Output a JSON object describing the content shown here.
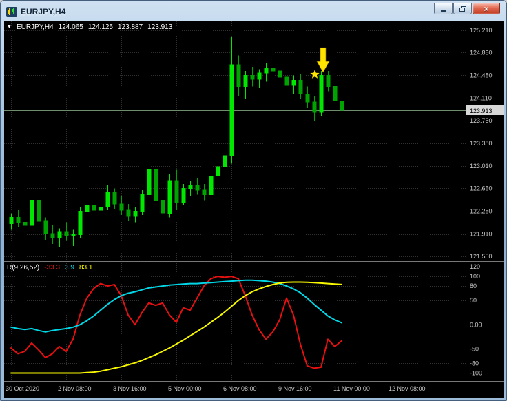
{
  "window": {
    "title": "EURJPY,H4",
    "controls": {
      "minimize": "minimize",
      "maximize": "restore",
      "close": "×"
    }
  },
  "main_chart": {
    "info": {
      "dropdown": "▼",
      "symbol": "EURJPY,H4",
      "open": "124.065",
      "high": "124.125",
      "low": "123.887",
      "close": "123.913"
    },
    "price_axis_labels": [
      "125.210",
      "124.850",
      "124.480",
      "124.110",
      "123.750",
      "123.380",
      "123.010",
      "122.650",
      "122.280",
      "121.910",
      "121.550"
    ],
    "bid_price": "123.913"
  },
  "indicator_panel": {
    "name": "R(9,26,52)",
    "value_red": "-33.3",
    "value_aqua": "3.9",
    "value_yellow": "83.1",
    "axis_labels": [
      "120",
      "100",
      "80",
      "50",
      "0.00",
      "-50",
      "-80",
      "-100"
    ]
  },
  "time_axis": {
    "labels": [
      "30 Oct 2020",
      "2 Nov 08:00",
      "3 Nov 16:00",
      "5 Nov 00:00",
      "6 Nov 08:00",
      "9 Nov 16:00",
      "11 Nov 00:00",
      "12 Nov 08:00"
    ],
    "label_bar_indexes": [
      0,
      8,
      16,
      24,
      32,
      40,
      48,
      56
    ]
  },
  "colors": {
    "bull": "#00e800",
    "bear": "#00a400",
    "grid": "#303030",
    "axis_text": "#c8c8c8",
    "red_line": "#e81010",
    "aqua_line": "#00d8e8",
    "yellow_line": "#f8f800",
    "marker": "#ffe400",
    "bid_line": "#6e8e6e",
    "bid_tag_bg": "#d8d8d8"
  },
  "chart_data": {
    "type": "candlestick",
    "symbol": "EURJPY",
    "timeframe": "H4",
    "title": "EURJPY,H4",
    "bid": 123.913,
    "y_axis_values": [
      125.21,
      124.85,
      124.48,
      124.11,
      123.75,
      123.38,
      123.01,
      122.65,
      122.28,
      121.91,
      121.55
    ],
    "ylim": [
      121.55,
      125.21
    ],
    "x_labels": [
      "30 Oct 2020",
      "2 Nov 08:00",
      "3 Nov 16:00",
      "5 Nov 00:00",
      "6 Nov 08:00",
      "9 Nov 16:00",
      "11 Nov 00:00",
      "12 Nov 08:00"
    ],
    "candles_ohlc": [
      [
        122.08,
        122.25,
        121.98,
        122.18
      ],
      [
        122.18,
        122.3,
        122.02,
        122.1
      ],
      [
        122.1,
        122.22,
        121.95,
        122.05
      ],
      [
        122.05,
        122.52,
        122.0,
        122.45
      ],
      [
        122.45,
        122.5,
        122.05,
        122.12
      ],
      [
        122.12,
        122.18,
        121.82,
        121.92
      ],
      [
        121.92,
        122.05,
        121.75,
        121.85
      ],
      [
        121.85,
        122.0,
        121.7,
        121.95
      ],
      [
        121.95,
        122.1,
        121.8,
        121.88
      ],
      [
        121.88,
        121.98,
        121.72,
        121.9
      ],
      [
        121.9,
        122.35,
        121.85,
        122.28
      ],
      [
        122.28,
        122.45,
        122.15,
        122.38
      ],
      [
        122.38,
        122.5,
        122.22,
        122.3
      ],
      [
        122.3,
        122.42,
        122.18,
        122.35
      ],
      [
        122.35,
        122.7,
        122.3,
        122.58
      ],
      [
        122.58,
        122.65,
        122.32,
        122.4
      ],
      [
        122.4,
        122.52,
        122.22,
        122.3
      ],
      [
        122.3,
        122.4,
        122.12,
        122.2
      ],
      [
        122.2,
        122.35,
        122.1,
        122.28
      ],
      [
        122.28,
        122.62,
        122.22,
        122.55
      ],
      [
        122.55,
        123.05,
        122.48,
        122.95
      ],
      [
        122.95,
        123.02,
        122.35,
        122.45
      ],
      [
        122.45,
        122.6,
        122.15,
        122.25
      ],
      [
        122.25,
        122.88,
        122.18,
        122.78
      ],
      [
        122.78,
        122.95,
        122.3,
        122.42
      ],
      [
        122.42,
        122.72,
        122.38,
        122.65
      ],
      [
        122.65,
        122.78,
        122.52,
        122.7
      ],
      [
        122.7,
        122.82,
        122.55,
        122.62
      ],
      [
        122.62,
        122.72,
        122.45,
        122.55
      ],
      [
        122.55,
        122.92,
        122.5,
        122.85
      ],
      [
        122.85,
        123.08,
        122.78,
        123.0
      ],
      [
        123.0,
        123.25,
        122.92,
        123.18
      ],
      [
        123.18,
        125.1,
        123.05,
        124.65
      ],
      [
        124.65,
        124.8,
        124.15,
        124.3
      ],
      [
        124.3,
        124.55,
        124.1,
        124.48
      ],
      [
        124.48,
        124.62,
        124.3,
        124.42
      ],
      [
        124.42,
        124.58,
        124.28,
        124.52
      ],
      [
        124.52,
        124.68,
        124.38,
        124.6
      ],
      [
        124.6,
        124.78,
        124.48,
        124.55
      ],
      [
        124.55,
        124.72,
        124.35,
        124.45
      ],
      [
        124.45,
        124.58,
        124.25,
        124.32
      ],
      [
        124.32,
        124.48,
        124.18,
        124.4
      ],
      [
        124.4,
        124.5,
        124.1,
        124.18
      ],
      [
        124.18,
        124.3,
        123.95,
        124.05
      ],
      [
        124.05,
        124.15,
        123.75,
        123.88
      ],
      [
        123.88,
        124.55,
        123.82,
        124.48
      ],
      [
        124.48,
        124.55,
        124.22,
        124.3
      ],
      [
        124.3,
        124.38,
        123.98,
        124.08
      ],
      [
        124.065,
        124.125,
        123.887,
        123.913
      ]
    ],
    "marker": {
      "bar_index": 45,
      "kind": "star-and-down-arrow"
    },
    "indicator": {
      "name": "R(9,26,52)",
      "type": "line",
      "levels": [
        120,
        100,
        80,
        50,
        0,
        -50,
        -80,
        -100
      ],
      "range": [
        -115,
        130
      ],
      "last_values": [
        -33.3,
        3.9,
        83.1
      ],
      "series": [
        {
          "name": "red",
          "color_key": "red_line",
          "values": [
            -48,
            -60,
            -55,
            -38,
            -52,
            -68,
            -60,
            -45,
            -55,
            -30,
            20,
            55,
            75,
            85,
            80,
            83,
            60,
            20,
            0,
            25,
            45,
            40,
            45,
            20,
            5,
            35,
            30,
            55,
            80,
            95,
            100,
            98,
            100,
            95,
            60,
            20,
            -10,
            -30,
            -15,
            10,
            55,
            20,
            -40,
            -85,
            -90,
            -88,
            -30,
            -45,
            -33.3
          ]
        },
        {
          "name": "aqua",
          "color_key": "aqua_line",
          "values": [
            -5,
            -8,
            -10,
            -8,
            -12,
            -15,
            -12,
            -10,
            -8,
            -5,
            0,
            8,
            18,
            30,
            42,
            52,
            60,
            65,
            68,
            72,
            76,
            78,
            80,
            82,
            83,
            84,
            85,
            85,
            86,
            87,
            88,
            89,
            90,
            91,
            92,
            92,
            91,
            90,
            88,
            85,
            80,
            74,
            66,
            55,
            42,
            30,
            18,
            10,
            3.9
          ]
        },
        {
          "name": "yellow",
          "color_key": "yellow_line",
          "values": [
            -100,
            -100,
            -100,
            -100,
            -100,
            -100,
            -100,
            -100,
            -100,
            -100,
            -100,
            -99,
            -98,
            -96,
            -93,
            -90,
            -87,
            -83,
            -79,
            -74,
            -68,
            -62,
            -55,
            -48,
            -40,
            -32,
            -23,
            -14,
            -5,
            5,
            15,
            26,
            38,
            50,
            60,
            68,
            74,
            79,
            83,
            86,
            87.5,
            88,
            88,
            87.5,
            87,
            86,
            85,
            84,
            83.1
          ]
        }
      ]
    }
  }
}
